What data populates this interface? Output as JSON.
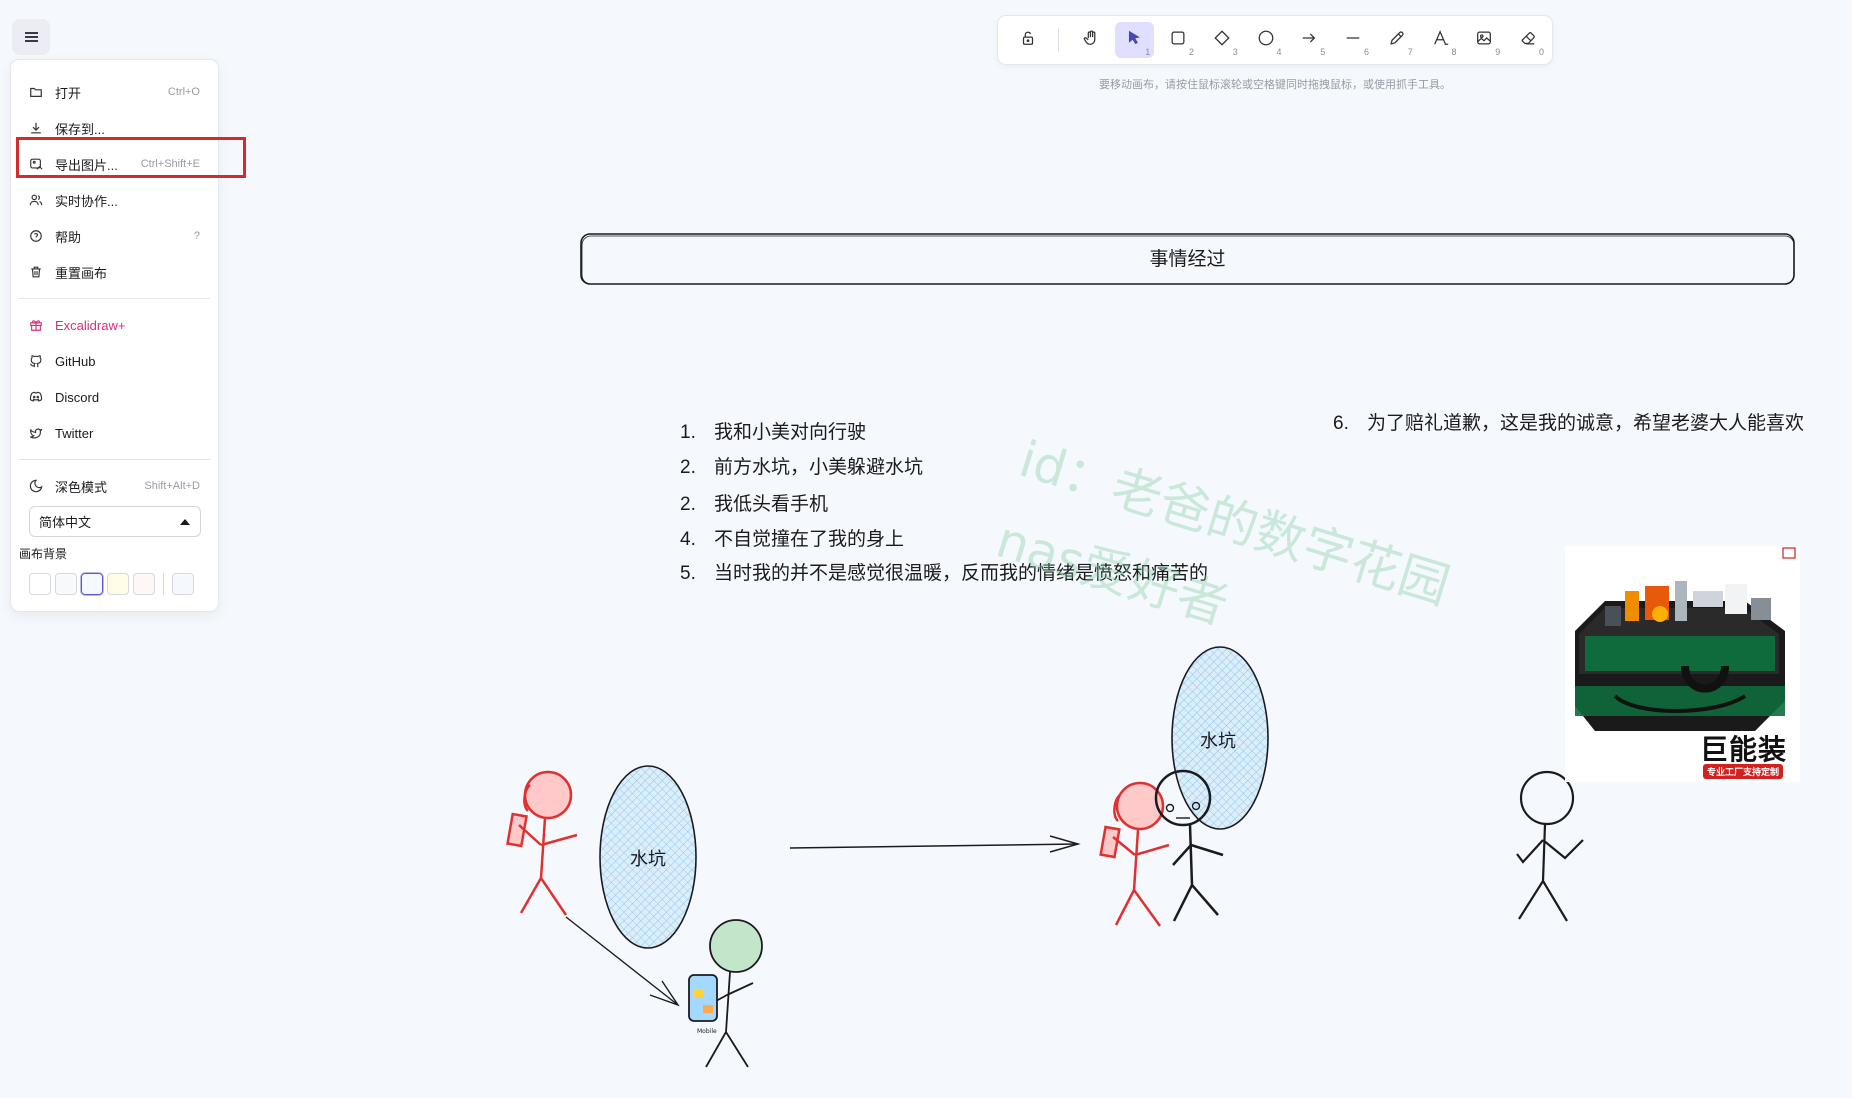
{
  "menu": {
    "items": [
      {
        "label": "打开",
        "shortcut": "Ctrl+O",
        "icon": "folder-icon"
      },
      {
        "label": "保存到...",
        "shortcut": "",
        "icon": "download-icon"
      },
      {
        "label": "导出图片...",
        "shortcut": "Ctrl+Shift+E",
        "icon": "export-image-icon"
      },
      {
        "label": "实时协作...",
        "shortcut": "",
        "icon": "users-icon"
      },
      {
        "label": "帮助",
        "shortcut": "?",
        "icon": "help-icon"
      },
      {
        "label": "重置画布",
        "shortcut": "",
        "icon": "trash-icon"
      }
    ],
    "links": [
      {
        "label": "Excalidraw+",
        "icon": "gift-icon"
      },
      {
        "label": "GitHub",
        "icon": "github-icon"
      },
      {
        "label": "Discord",
        "icon": "discord-icon"
      },
      {
        "label": "Twitter",
        "icon": "twitter-icon"
      }
    ],
    "dark_mode": {
      "label": "深色模式",
      "shortcut": "Shift+Alt+D",
      "icon": "moon-icon"
    },
    "language": "简体中文",
    "background_label": "画布背景",
    "background_swatches": [
      "#ffffff",
      "#f8f9fa",
      "#f5faff",
      "#fffce8",
      "#fdf8f6",
      "#f5f9fd"
    ],
    "selected_swatch_index": 2
  },
  "toolbar": {
    "tools": [
      {
        "name": "lock",
        "num": ""
      },
      {
        "name": "hand",
        "num": ""
      },
      {
        "name": "selection",
        "num": "1",
        "active": true
      },
      {
        "name": "rectangle",
        "num": "2"
      },
      {
        "name": "diamond",
        "num": "3"
      },
      {
        "name": "ellipse",
        "num": "4"
      },
      {
        "name": "arrow",
        "num": "5"
      },
      {
        "name": "line",
        "num": "6"
      },
      {
        "name": "draw",
        "num": "7"
      },
      {
        "name": "text",
        "num": "8"
      },
      {
        "name": "image",
        "num": "9"
      },
      {
        "name": "eraser",
        "num": "0"
      }
    ],
    "hint": "要移动画布，请按住鼠标滚轮或空格键同时拖拽鼠标，或使用抓手工具。"
  },
  "canvas": {
    "title": "事情经过",
    "list": [
      {
        "n": "1.",
        "text": "我和小美对向行驶"
      },
      {
        "n": "2.",
        "text": "前方水坑，小美躲避水坑"
      },
      {
        "n": "2.",
        "text": "我低头看手机"
      },
      {
        "n": "4.",
        "text": "不自觉撞在了我的身上"
      },
      {
        "n": "5.",
        "text": "当时我的并不是感觉很温暖，反而我的情绪是愤怒和痛苦的"
      }
    ],
    "item6": {
      "n": "6.",
      "text": "为了赔礼道歉，这是我的诚意，希望老婆大人能喜欢"
    },
    "watermark_line1": "id：老爸的数字花园",
    "watermark_line2": "nas爱好者",
    "puddle_label": "水坑",
    "product_text": "巨能装",
    "product_sub": "专业工厂支持定制",
    "phone_label": "Mobile"
  }
}
